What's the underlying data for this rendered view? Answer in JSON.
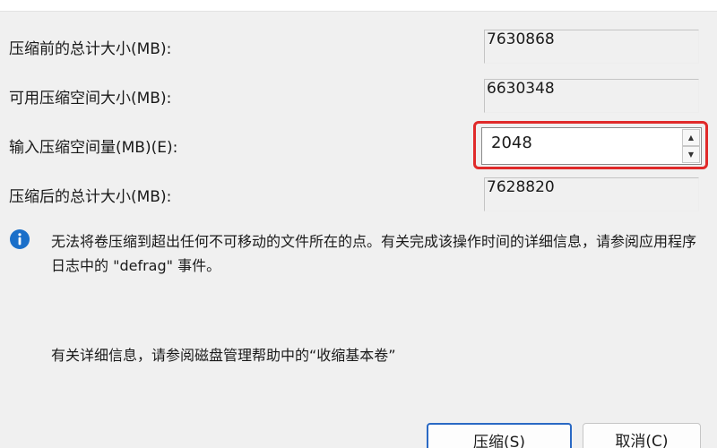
{
  "fields": {
    "total_before": {
      "label": "压缩前的总计大小(MB):",
      "value": "7630868"
    },
    "available": {
      "label": "可用压缩空间大小(MB):",
      "value": "6630348"
    },
    "shrink_amount": {
      "label": "输入压缩空间量(MB)(E):",
      "value": "2048"
    },
    "total_after": {
      "label": "压缩后的总计大小(MB):",
      "value": "7628820"
    }
  },
  "info": {
    "icon": "info-icon",
    "text": "无法将卷压缩到超出任何不可移动的文件所在的点。有关完成该操作时间的详细信息，请参阅应用程序日志中的 \"defrag\" 事件。"
  },
  "help_text": "有关详细信息，请参阅磁盘管理帮助中的“收缩基本卷”",
  "buttons": {
    "shrink": "压缩(S)",
    "cancel": "取消(C)"
  },
  "colors": {
    "highlight": "#e02a2a",
    "info_icon": "#1a6fc9",
    "primary_border": "#2a69c4"
  }
}
